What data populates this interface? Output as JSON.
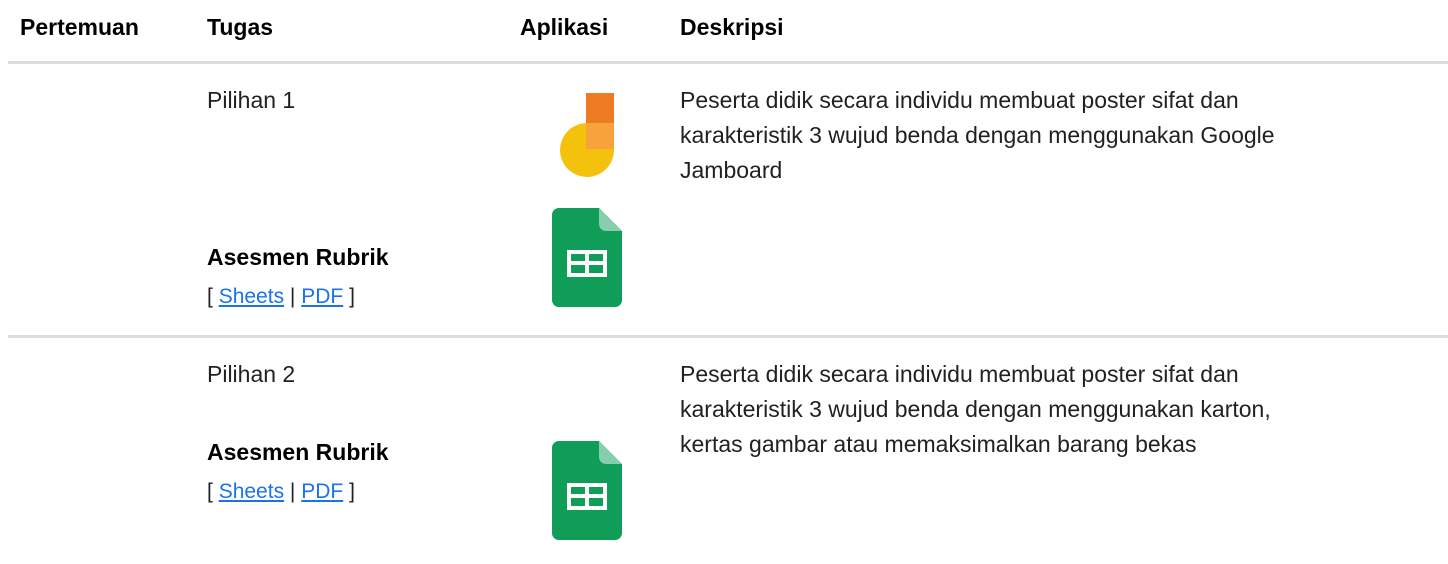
{
  "headers": {
    "pertemuan": "Pertemuan",
    "tugas": "Tugas",
    "aplikasi": "Aplikasi",
    "deskripsi": "Deskripsi"
  },
  "rows": [
    {
      "task": "Pilihan 1",
      "assessment_label": "Asesmen Rubrik",
      "bracket_open": "[",
      "link_sheets": "Sheets",
      "separator": "|",
      "link_pdf": "PDF",
      "bracket_close": "]",
      "description": [
        "Peserta didik secara individu membuat poster sifat dan",
        "karakteristik 3 wujud benda dengan menggunakan Google",
        "Jamboard"
      ],
      "apps": [
        "jamboard-icon",
        "google-sheets-icon"
      ]
    },
    {
      "task": "Pilihan 2",
      "assessment_label": "Asesmen Rubrik",
      "bracket_open": "[",
      "link_sheets": "Sheets",
      "separator": "|",
      "link_pdf": "PDF",
      "bracket_close": "]",
      "description": [
        "Peserta didik secara individu membuat poster sifat dan",
        "karakteristik 3 wujud benda dengan menggunakan karton,",
        "kertas gambar atau memaksimalkan barang bekas"
      ],
      "apps": [
        "google-sheets-icon"
      ]
    }
  ],
  "colors": {
    "link": "#1a73e8",
    "divider": "#dadce0",
    "sheets_green": "#0f9d58",
    "jamboard_yellow": "#f4c20d",
    "jamboard_orange": "#f4811f"
  }
}
